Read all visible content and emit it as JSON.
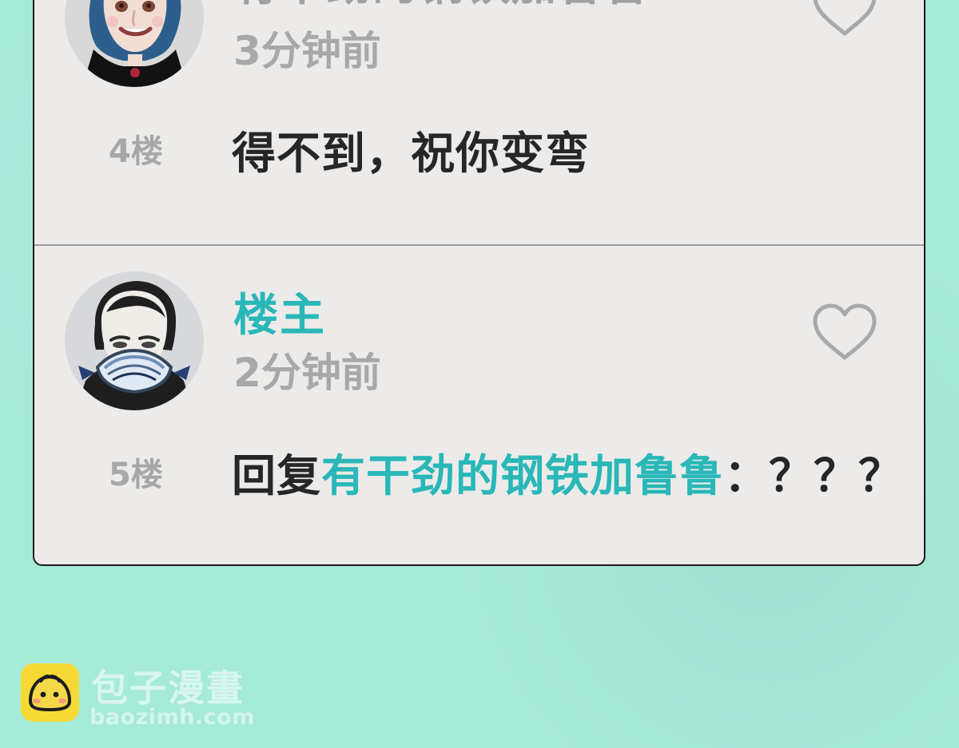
{
  "colors": {
    "background": "#a6ead8",
    "card": "#ecebe9",
    "border": "#1b1b1b",
    "accent": "#29b7b8",
    "muted": "#a8a8a8",
    "text": "#262626",
    "watermark_logo": "#f6d935"
  },
  "comments": [
    {
      "name": "有干劲的钢铁加鲁鲁",
      "time": "3分钟前",
      "floor": "4楼",
      "content": "得不到，祝你变弯",
      "avatar_icon": "girl-avatar-icon",
      "like_icon": "heart-icon"
    },
    {
      "name": "楼主",
      "time": "2分钟前",
      "floor": "5楼",
      "content_prefix": "回复",
      "content_reply_target": "有干劲的钢铁加鲁鲁",
      "content_suffix": "：？？？",
      "avatar_icon": "masked-man-avatar-icon",
      "like_icon": "heart-icon"
    }
  ],
  "watermark": {
    "title": "包子漫畫",
    "subtitle": "baozimh.com",
    "logo_icon": "bun-face-icon"
  }
}
